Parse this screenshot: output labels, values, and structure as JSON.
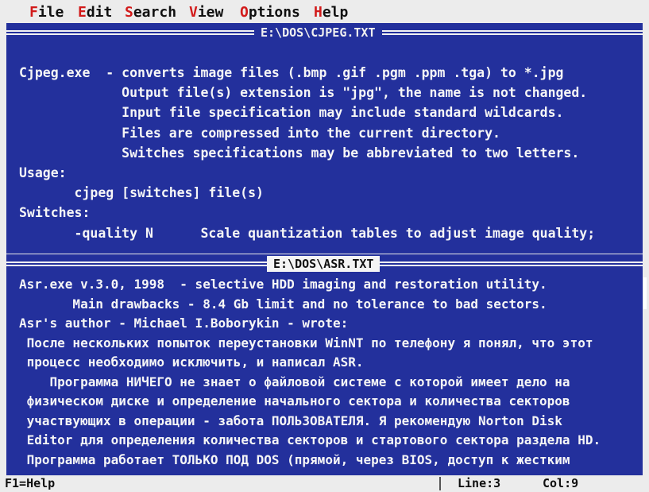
{
  "menu": [
    {
      "hot": "F",
      "rest": "ile"
    },
    {
      "hot": "E",
      "rest": "dit"
    },
    {
      "hot": "S",
      "rest": "earch"
    },
    {
      "hot": "V",
      "rest": "iew"
    },
    {
      "hot": "O",
      "rest": "ptions"
    },
    {
      "hot": "H",
      "rest": "elp"
    }
  ],
  "panes": [
    {
      "title": "E:\\DOS\\CJPEG.TXT",
      "lines": [
        "Cjpeg.exe  - converts image files (.bmp .gif .pgm .ppm .tga) to *.jpg",
        "             Output file(s) extension is \"jpg\", the name is not changed.",
        "             Input file specification may include standard wildcards.",
        "             Files are compressed into the current directory.",
        "             Switches specifications may be abbreviated to two letters.",
        "Usage:",
        "       cjpeg [switches] file(s)",
        "Switches:",
        "       -quality N      Scale quantization tables to adjust image quality;"
      ]
    },
    {
      "title": "E:\\DOS\\ASR.TXT",
      "lines": [
        "Asr.exe v.3.0, 1998  - selective HDD imaging and restoration utility.",
        "       Main drawbacks - 8.4 Gb limit and no tolerance to bad sectors.",
        "Asr's author - Michael I.Boborykin - wrote:",
        " После нескольких попыток переустановки WinNT по телефону я понял, что этот",
        " процесс необходимо исключить, и написал ASR.",
        "    Программа НИЧЕГО не знает о файловой системе с которой имеет дело на",
        " физическом диске и определение начального сектора и количества секторов",
        " участвующих в операции - забота ПОЛЬЗОВАТЕЛЯ. Я рекомендую Norton Disk",
        " Editor для определения количества секторов и стартового сектора раздела HD.",
        " Программа работает ТОЛЬКО ПОД DOS (прямой, через BIOS, доступ к жестким"
      ]
    }
  ],
  "status": {
    "help": "F1=Help",
    "line": "Line:3",
    "col": "Col:9"
  },
  "colors": {
    "pane_bg": "#23309c",
    "text": "#f6f6f6",
    "chrome": "#ececec",
    "hotkey": "#d21b1b"
  }
}
